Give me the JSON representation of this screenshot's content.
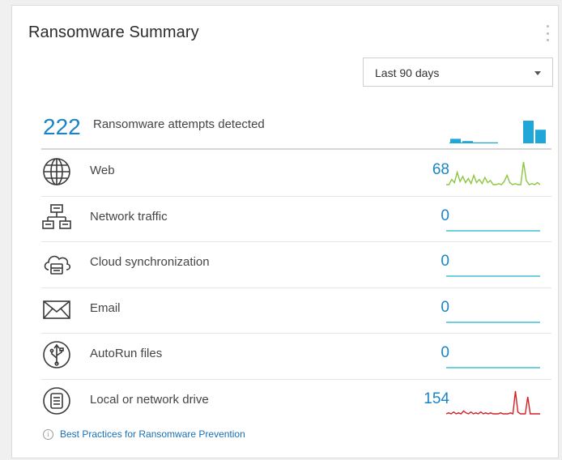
{
  "widget": {
    "title": "Ransomware Summary",
    "menu_icon": "kebab-menu-icon"
  },
  "filter": {
    "selected": "Last 90 days",
    "icon": "caret-down-icon"
  },
  "total": {
    "count": "222",
    "label": "Ransomware attempts detected",
    "bars": [
      2,
      1,
      0,
      0,
      0,
      0,
      10,
      6
    ]
  },
  "vectors": [
    {
      "name": "web",
      "label": "Web",
      "count": "68",
      "icon": "globe-icon",
      "color": "#8cc63f",
      "trend": [
        0,
        0,
        5,
        2,
        12,
        3,
        8,
        2,
        6,
        1,
        9,
        2,
        5,
        1,
        7,
        2,
        4,
        0,
        0,
        1,
        0,
        3,
        9,
        2,
        0,
        1,
        0,
        0,
        22,
        4,
        0,
        1,
        0,
        2,
        0
      ]
    },
    {
      "name": "network-traffic",
      "label": "Network traffic",
      "count": "0",
      "icon": "network-icon",
      "color": "#3ebfd3",
      "trend": [
        0,
        0,
        0,
        0,
        0,
        0,
        0,
        0,
        0,
        0
      ]
    },
    {
      "name": "cloud-sync",
      "label": "Cloud synchronization",
      "count": "0",
      "icon": "cloud-sync-icon",
      "color": "#3ebfd3",
      "trend": [
        0,
        0,
        0,
        0,
        0,
        0,
        0,
        0,
        0,
        0
      ]
    },
    {
      "name": "email",
      "label": "Email",
      "count": "0",
      "icon": "envelope-icon",
      "color": "#3ebfd3",
      "trend": [
        0,
        0,
        0,
        0,
        0,
        0,
        0,
        0,
        0,
        0
      ]
    },
    {
      "name": "autorun",
      "label": "AutoRun files",
      "count": "0",
      "icon": "usb-icon",
      "color": "#3ebfd3",
      "trend": [
        0,
        0,
        0,
        0,
        0,
        0,
        0,
        0,
        0,
        0
      ]
    },
    {
      "name": "local-drive",
      "label": "Local or network drive",
      "count": "154",
      "icon": "drive-icon",
      "color": "#d31f26",
      "trend": [
        0,
        1,
        0,
        2,
        0,
        1,
        0,
        3,
        1,
        0,
        2,
        0,
        1,
        0,
        2,
        0,
        1,
        0,
        1,
        0,
        0,
        0,
        1,
        0,
        0,
        0,
        1,
        0,
        24,
        2,
        0,
        0,
        0,
        18,
        0,
        0,
        0,
        0,
        0
      ]
    }
  ],
  "footer": {
    "link": "Best Practices for Ransomware Prevention",
    "icon": "info-icon"
  }
}
